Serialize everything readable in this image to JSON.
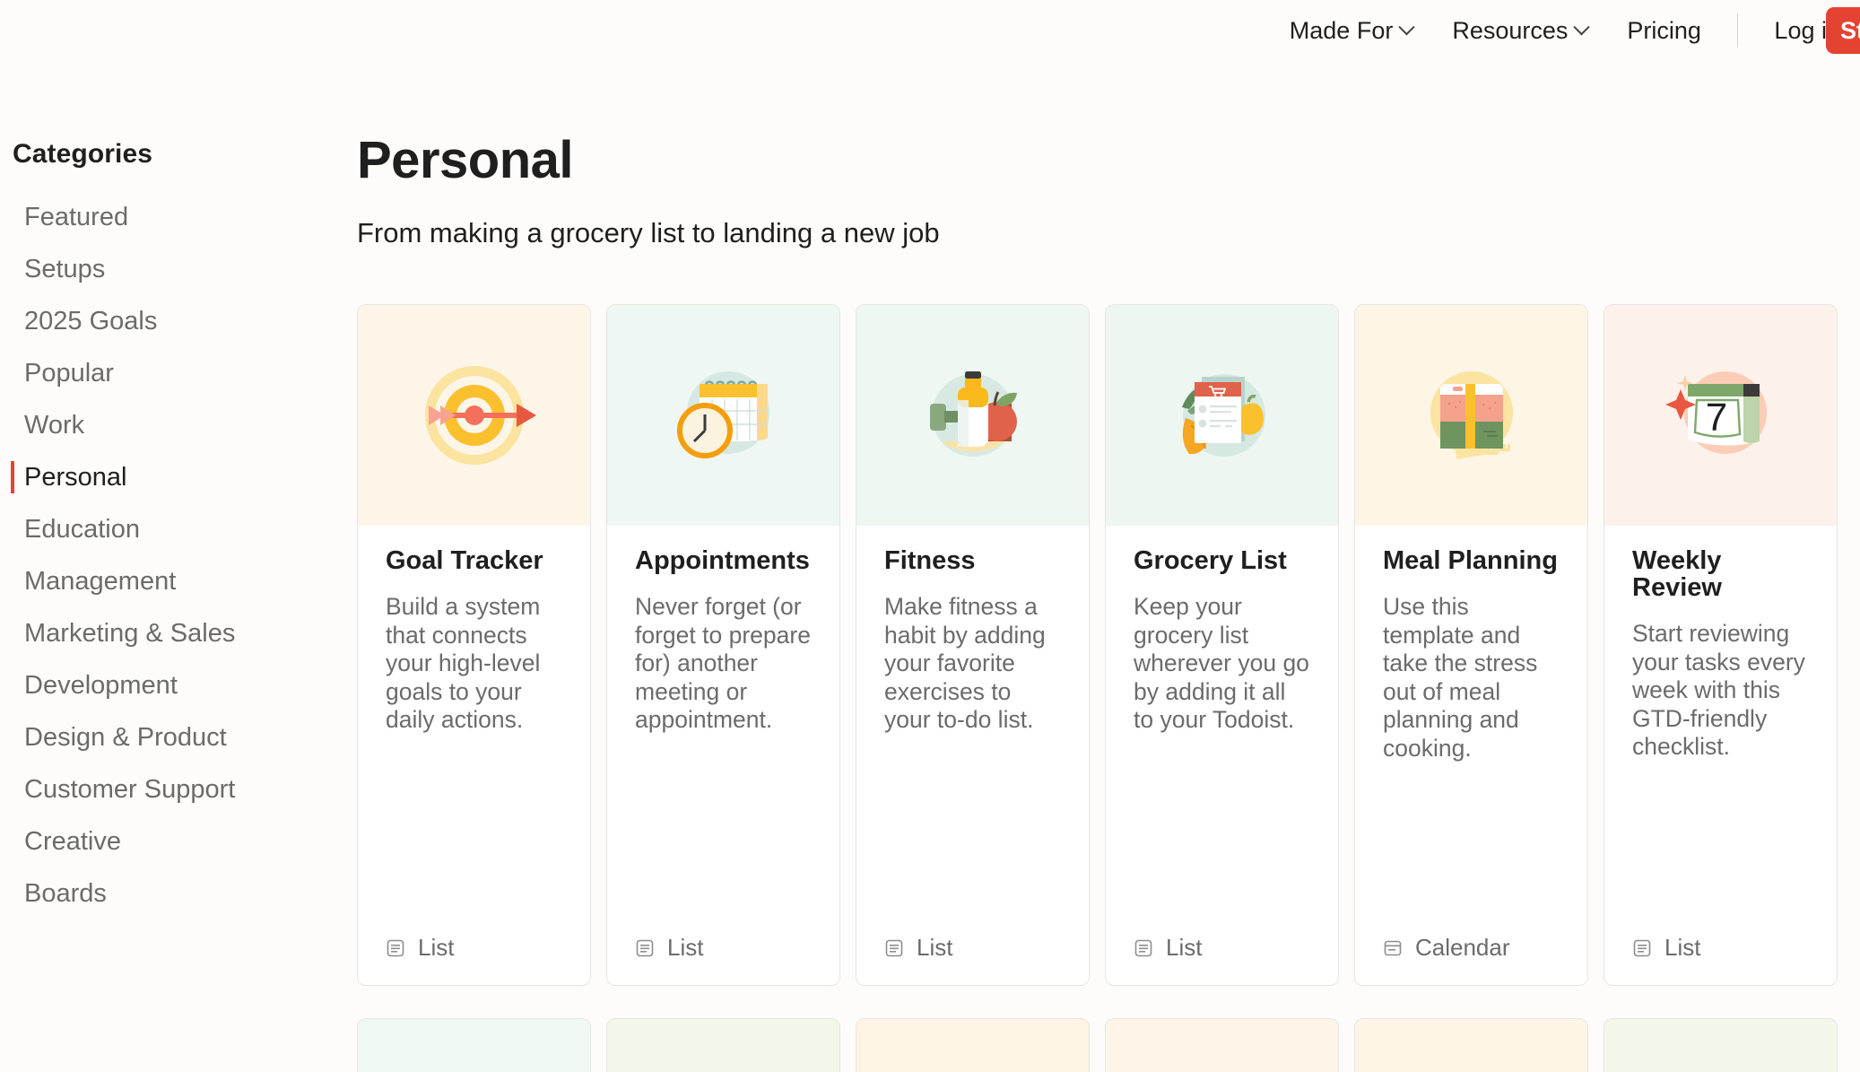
{
  "nav": {
    "items": [
      {
        "label": "Made For",
        "has_caret": true
      },
      {
        "label": "Resources",
        "has_caret": true
      },
      {
        "label": "Pricing",
        "has_caret": false
      }
    ],
    "login_label": "Log in",
    "signup_label": "Start for free",
    "accent_color": "#e44332"
  },
  "sidebar": {
    "title": "Categories",
    "items": [
      {
        "label": "Featured",
        "active": false
      },
      {
        "label": "Setups",
        "active": false
      },
      {
        "label": "2025 Goals",
        "active": false
      },
      {
        "label": "Popular",
        "active": false
      },
      {
        "label": "Work",
        "active": false
      },
      {
        "label": "Personal",
        "active": true
      },
      {
        "label": "Education",
        "active": false
      },
      {
        "label": "Management",
        "active": false
      },
      {
        "label": "Marketing & Sales",
        "active": false
      },
      {
        "label": "Development",
        "active": false
      },
      {
        "label": "Design & Product",
        "active": false
      },
      {
        "label": "Customer Support",
        "active": false
      },
      {
        "label": "Creative",
        "active": false
      },
      {
        "label": "Boards",
        "active": false
      }
    ]
  },
  "main": {
    "title": "Personal",
    "subtitle": "From making a grocery list to landing a new job"
  },
  "cards": [
    {
      "title": "Goal Tracker",
      "description": "Build a system that connects your high-level goals to your daily actions.",
      "view_type": "List",
      "view_icon": "list-icon",
      "art_icon": "target-arrow-icon",
      "art_bg": "#fdf6e8"
    },
    {
      "title": "Appointments",
      "description": "Never forget (or forget to prepare for) another meeting or appointment.",
      "view_type": "List",
      "view_icon": "list-icon",
      "art_icon": "calendar-clock-icon",
      "art_bg": "#eef7f3"
    },
    {
      "title": "Fitness",
      "description": "Make fitness a habit by adding your favorite exercises to your to-do list.",
      "view_type": "List",
      "view_icon": "list-icon",
      "art_icon": "water-bottle-apple-dumbbell-icon",
      "art_bg": "#eef7f2"
    },
    {
      "title": "Grocery List",
      "description": "Keep your grocery list wherever you go by adding it all to your Todoist.",
      "view_type": "List",
      "view_icon": "list-icon",
      "art_icon": "shopping-list-vegetables-icon",
      "art_bg": "#edf6f1"
    },
    {
      "title": "Meal Planning",
      "description": "Use this template and take the stress out of meal planning and cooking.",
      "view_type": "Calendar",
      "view_icon": "calendar-icon",
      "art_icon": "bento-box-fork-icon",
      "art_bg": "#fdf5e6"
    },
    {
      "title": "Weekly Review",
      "description": "Start reviewing your tasks every week with this GTD-friendly checklist.",
      "view_type": "List",
      "view_icon": "list-icon",
      "art_icon": "calendar-seven-sparkle-icon",
      "art_bg": "#fdf1ec"
    }
  ],
  "next_row_card_tints": [
    "#f0f8f4",
    "#f2f7e9",
    "#fdf4e5",
    "#fdf5e7",
    "#fdf5e6",
    "#f2f7ea"
  ]
}
